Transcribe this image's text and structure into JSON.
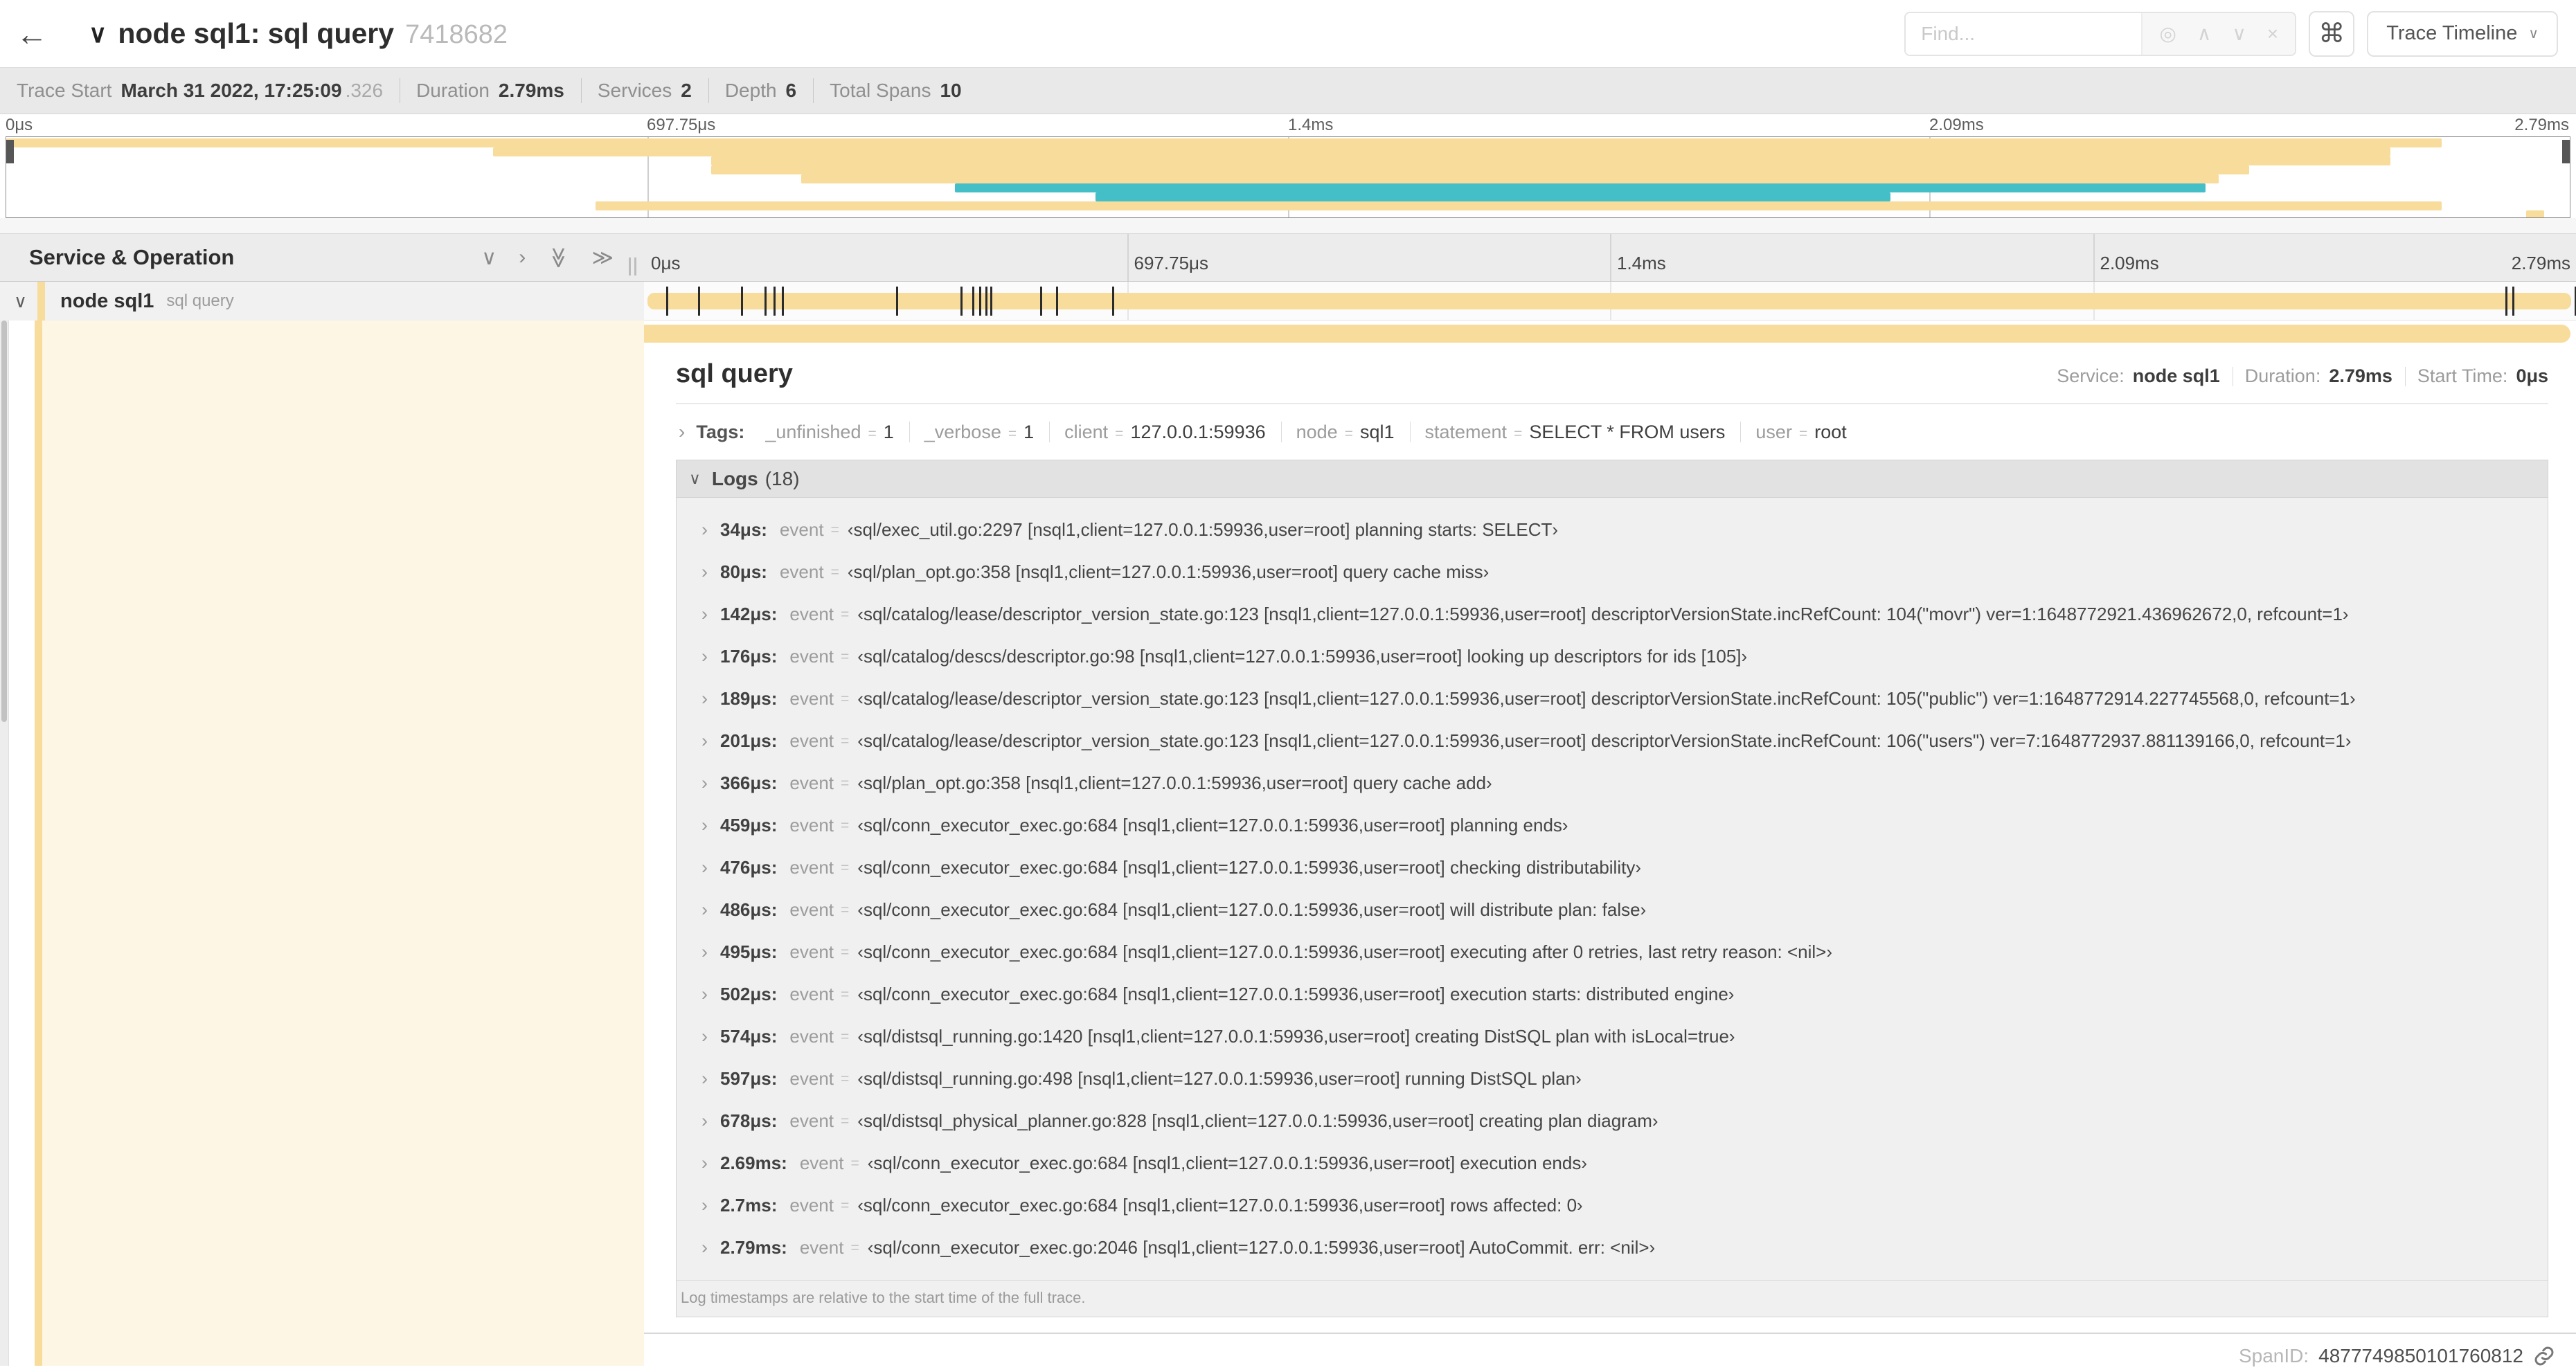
{
  "colors": {
    "tan": "#f7dc9b",
    "teal": "#45bfc7",
    "cream": "#fdf6e4"
  },
  "header": {
    "back_icon": "←",
    "title": "node sql1: sql query",
    "trace_id": "7418682",
    "find_placeholder": "Find...",
    "keyboard_shortcut_icon": "⌘",
    "view_label": "Trace Timeline"
  },
  "stats": {
    "trace_start_label": "Trace Start",
    "trace_start": "March 31 2022, 17:25:09",
    "trace_start_frac": ".326",
    "duration_label": "Duration",
    "duration": "2.79ms",
    "services_label": "Services",
    "services": "2",
    "depth_label": "Depth",
    "depth": "6",
    "total_spans_label": "Total Spans",
    "total_spans": "10"
  },
  "ruler_ticks": [
    "0μs",
    "697.75μs",
    "1.4ms",
    "2.09ms",
    "2.79ms"
  ],
  "minimap": {
    "spans": [
      {
        "color": "tan",
        "start": 0,
        "end": 95.0
      },
      {
        "color": "tan",
        "start": 19.0,
        "end": 93.0
      },
      {
        "color": "tan",
        "start": 27.5,
        "end": 93.0
      },
      {
        "color": "tan",
        "start": 27.5,
        "end": 87.5
      },
      {
        "color": "tan",
        "start": 31.0,
        "end": 86.3
      },
      {
        "color": "teal",
        "start": 37.0,
        "end": 85.8
      },
      {
        "color": "teal",
        "start": 42.5,
        "end": 73.5
      },
      {
        "color": "tan",
        "start": 23.0,
        "end": 95.0
      },
      {
        "color": "tan",
        "start": 98.3,
        "end": 99.0
      }
    ]
  },
  "timeline": {
    "header_label": "Service & Operation",
    "row": {
      "service": "node sql1",
      "operation": "sql query"
    }
  },
  "detail": {
    "title": "sql query",
    "service_label": "Service:",
    "service": "node sql1",
    "duration_label": "Duration:",
    "duration": "2.79ms",
    "start_label": "Start Time:",
    "start": "0μs",
    "tags_label": "Tags:",
    "tags": [
      {
        "key": "_unfinished",
        "value": "1"
      },
      {
        "key": "_verbose",
        "value": "1"
      },
      {
        "key": "client",
        "value": "127.0.0.1:59936"
      },
      {
        "key": "node",
        "value": "sql1"
      },
      {
        "key": "statement",
        "value": "SELECT * FROM users"
      },
      {
        "key": "user",
        "value": "root"
      }
    ],
    "logs_label": "Logs",
    "logs_count": "(18)",
    "duration_us": 2790,
    "logs": [
      {
        "time": "34μs:",
        "t": 34,
        "field": "event",
        "value": "‹sql/exec_util.go:2297 [nsql1,client=127.0.0.1:59936,user=root] planning starts: SELECT›"
      },
      {
        "time": "80μs:",
        "t": 80,
        "field": "event",
        "value": "‹sql/plan_opt.go:358 [nsql1,client=127.0.0.1:59936,user=root] query cache miss›"
      },
      {
        "time": "142μs:",
        "t": 142,
        "field": "event",
        "value": "‹sql/catalog/lease/descriptor_version_state.go:123 [nsql1,client=127.0.0.1:59936,user=root] descriptorVersionState.incRefCount: 104(\"movr\") ver=1:1648772921.436962672,0, refcount=1›"
      },
      {
        "time": "176μs:",
        "t": 176,
        "field": "event",
        "value": "‹sql/catalog/descs/descriptor.go:98 [nsql1,client=127.0.0.1:59936,user=root] looking up descriptors for ids [105]›"
      },
      {
        "time": "189μs:",
        "t": 189,
        "field": "event",
        "value": "‹sql/catalog/lease/descriptor_version_state.go:123 [nsql1,client=127.0.0.1:59936,user=root] descriptorVersionState.incRefCount: 105(\"public\") ver=1:1648772914.227745568,0, refcount=1›"
      },
      {
        "time": "201μs:",
        "t": 201,
        "field": "event",
        "value": "‹sql/catalog/lease/descriptor_version_state.go:123 [nsql1,client=127.0.0.1:59936,user=root] descriptorVersionState.incRefCount: 106(\"users\") ver=7:1648772937.881139166,0, refcount=1›"
      },
      {
        "time": "366μs:",
        "t": 366,
        "field": "event",
        "value": "‹sql/plan_opt.go:358 [nsql1,client=127.0.0.1:59936,user=root] query cache add›"
      },
      {
        "time": "459μs:",
        "t": 459,
        "field": "event",
        "value": "‹sql/conn_executor_exec.go:684 [nsql1,client=127.0.0.1:59936,user=root] planning ends›"
      },
      {
        "time": "476μs:",
        "t": 476,
        "field": "event",
        "value": "‹sql/conn_executor_exec.go:684 [nsql1,client=127.0.0.1:59936,user=root] checking distributability›"
      },
      {
        "time": "486μs:",
        "t": 486,
        "field": "event",
        "value": "‹sql/conn_executor_exec.go:684 [nsql1,client=127.0.0.1:59936,user=root] will distribute plan: false›"
      },
      {
        "time": "495μs:",
        "t": 495,
        "field": "event",
        "value": "‹sql/conn_executor_exec.go:684 [nsql1,client=127.0.0.1:59936,user=root] executing after 0 retries, last retry reason: <nil>›"
      },
      {
        "time": "502μs:",
        "t": 502,
        "field": "event",
        "value": "‹sql/conn_executor_exec.go:684 [nsql1,client=127.0.0.1:59936,user=root] execution starts: distributed engine›"
      },
      {
        "time": "574μs:",
        "t": 574,
        "field": "event",
        "value": "‹sql/distsql_running.go:1420 [nsql1,client=127.0.0.1:59936,user=root] creating DistSQL plan with isLocal=true›"
      },
      {
        "time": "597μs:",
        "t": 597,
        "field": "event",
        "value": "‹sql/distsql_running.go:498 [nsql1,client=127.0.0.1:59936,user=root] running DistSQL plan›"
      },
      {
        "time": "678μs:",
        "t": 678,
        "field": "event",
        "value": "‹sql/distsql_physical_planner.go:828 [nsql1,client=127.0.0.1:59936,user=root] creating plan diagram›"
      },
      {
        "time": "2.69ms:",
        "t": 2690,
        "field": "event",
        "value": "‹sql/conn_executor_exec.go:684 [nsql1,client=127.0.0.1:59936,user=root] execution ends›"
      },
      {
        "time": "2.7ms:",
        "t": 2700,
        "field": "event",
        "value": "‹sql/conn_executor_exec.go:684 [nsql1,client=127.0.0.1:59936,user=root] rows affected: 0›"
      },
      {
        "time": "2.79ms:",
        "t": 2790,
        "field": "event",
        "value": "‹sql/conn_executor_exec.go:2046 [nsql1,client=127.0.0.1:59936,user=root] AutoCommit. err: <nil>›"
      }
    ],
    "footer": "Log timestamps are relative to the start time of the full trace.",
    "span_id_label": "SpanID:",
    "span_id": "4877749850101760812"
  }
}
